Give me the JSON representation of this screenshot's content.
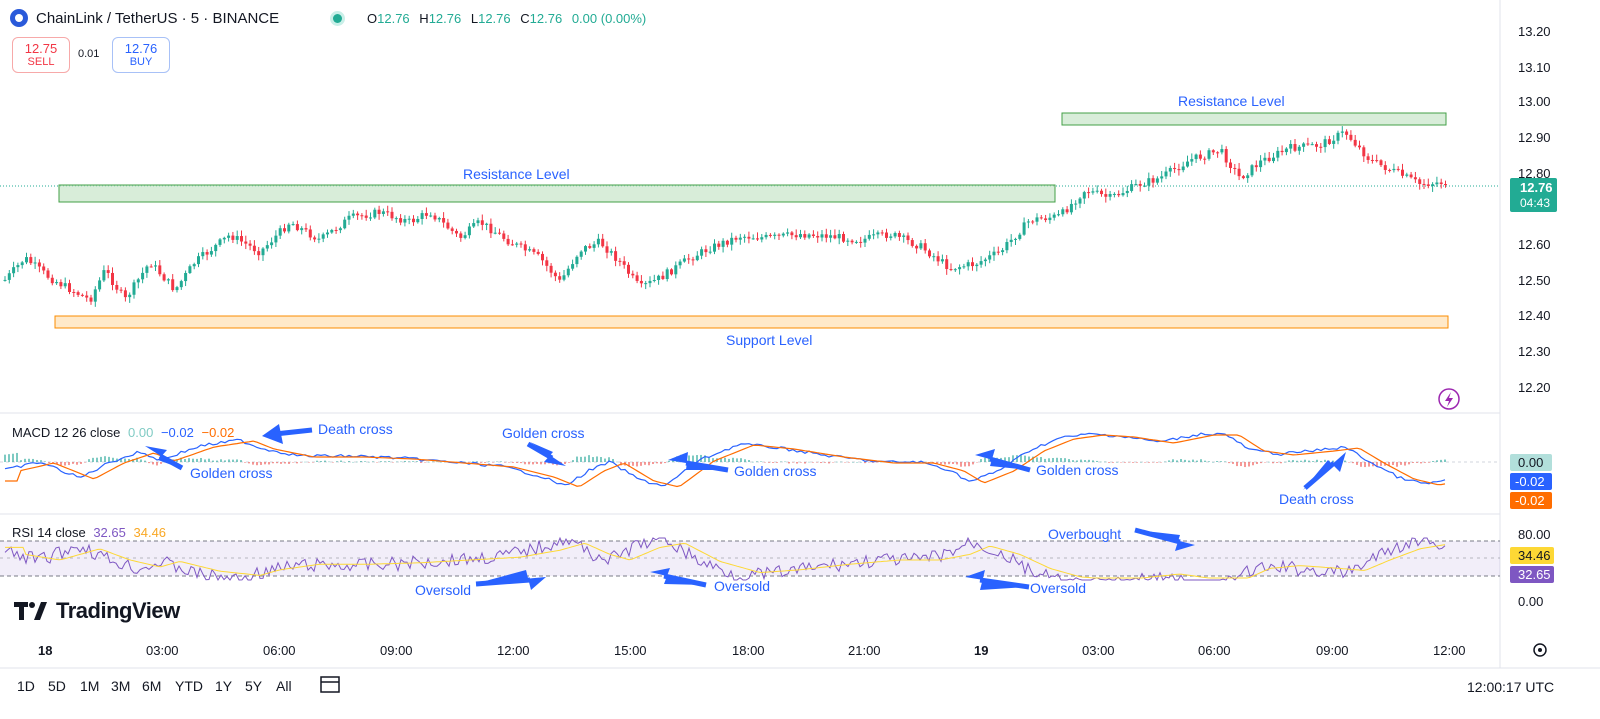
{
  "header": {
    "symbol_title": "ChainLink / TetherUS · 5 · BINANCE",
    "ohlc": [
      {
        "k": "O",
        "v": "12.76"
      },
      {
        "k": "H",
        "v": "12.76"
      },
      {
        "k": "L",
        "v": "12.76"
      },
      {
        "k": "C",
        "v": "12.76"
      },
      {
        "k": "",
        "v": "0.00 (0.00%)"
      }
    ]
  },
  "trade": {
    "sell_price": "12.75",
    "sell_label": "SELL",
    "spread": "0.01",
    "buy_price": "12.76",
    "buy_label": "BUY"
  },
  "price_axis": {
    "ticks": [
      "13.20",
      "13.10",
      "13.00",
      "12.90",
      "12.80",
      "12.60",
      "12.50",
      "12.40",
      "12.30",
      "12.20"
    ],
    "current_price": "12.76",
    "countdown": "04:43"
  },
  "annotations": {
    "resistance_upper": "Resistance Level",
    "resistance_lower": "Resistance Level",
    "support": "Support Level",
    "macd_notes": [
      "Death cross",
      "Golden cross",
      "Golden cross",
      "Golden cross",
      "Golden cross",
      "Death cross"
    ],
    "rsi_notes": [
      "Overbought",
      "Oversold",
      "Oversold",
      "Oversold"
    ]
  },
  "macd": {
    "label": "MACD 12 26 close",
    "hist": "0.00",
    "macd": "−0.02",
    "signal": "−0.02",
    "axis_hist": "0.00",
    "axis_macd": "-0.02",
    "axis_signal": "-0.02",
    "colors": {
      "hist": "#b2dfdb",
      "macd": "#2962ff",
      "signal": "#ff6d00"
    }
  },
  "rsi": {
    "label": "RSI 14 close",
    "value": "32.65",
    "ma": "34.46",
    "axis_ticks": [
      "80.00",
      "0.00"
    ],
    "colors": {
      "rsi": "#7e57c2",
      "ma": "#fdd835"
    }
  },
  "time_axis": [
    "18",
    "03:00",
    "06:00",
    "09:00",
    "12:00",
    "15:00",
    "18:00",
    "21:00",
    "19",
    "03:00",
    "06:00",
    "09:00",
    "12:00"
  ],
  "ranges": [
    "1D",
    "5D",
    "1M",
    "3M",
    "6M",
    "YTD",
    "1Y",
    "5Y",
    "All"
  ],
  "clock": "12:00:17 UTC",
  "brand": "TradingView",
  "colors": {
    "up": "#22ab94",
    "down": "#f23645",
    "annotation": "#2962ff"
  }
}
